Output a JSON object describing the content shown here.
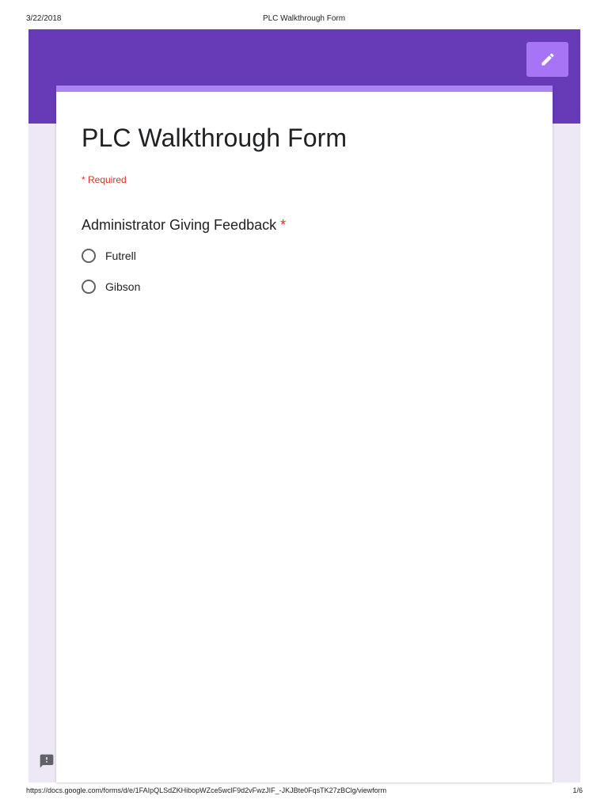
{
  "print_header": {
    "date": "3/22/2018",
    "title": "PLC Walkthrough Form"
  },
  "form": {
    "title": "PLC Walkthrough Form",
    "required_note": "* Required",
    "question": {
      "label": "Administrator Giving Feedback",
      "required_marker": "*",
      "options": [
        "Futrell",
        "Gibson"
      ]
    },
    "edit_icon": "pencil-icon",
    "feedback_icon": "report-problem-icon"
  },
  "print_footer": {
    "url": "https://docs.google.com/forms/d/e/1FAIpQLSdZKHibopWZce5wclF9d2vFwzJIF_-JKJBte0FqsTK27zBClg/viewform",
    "page": "1/6"
  },
  "colors": {
    "header": "#673ab7",
    "background": "#ede7f6",
    "card_accent": "#ab85f2",
    "edit_button": "#a774f5",
    "required": "#d93025"
  }
}
